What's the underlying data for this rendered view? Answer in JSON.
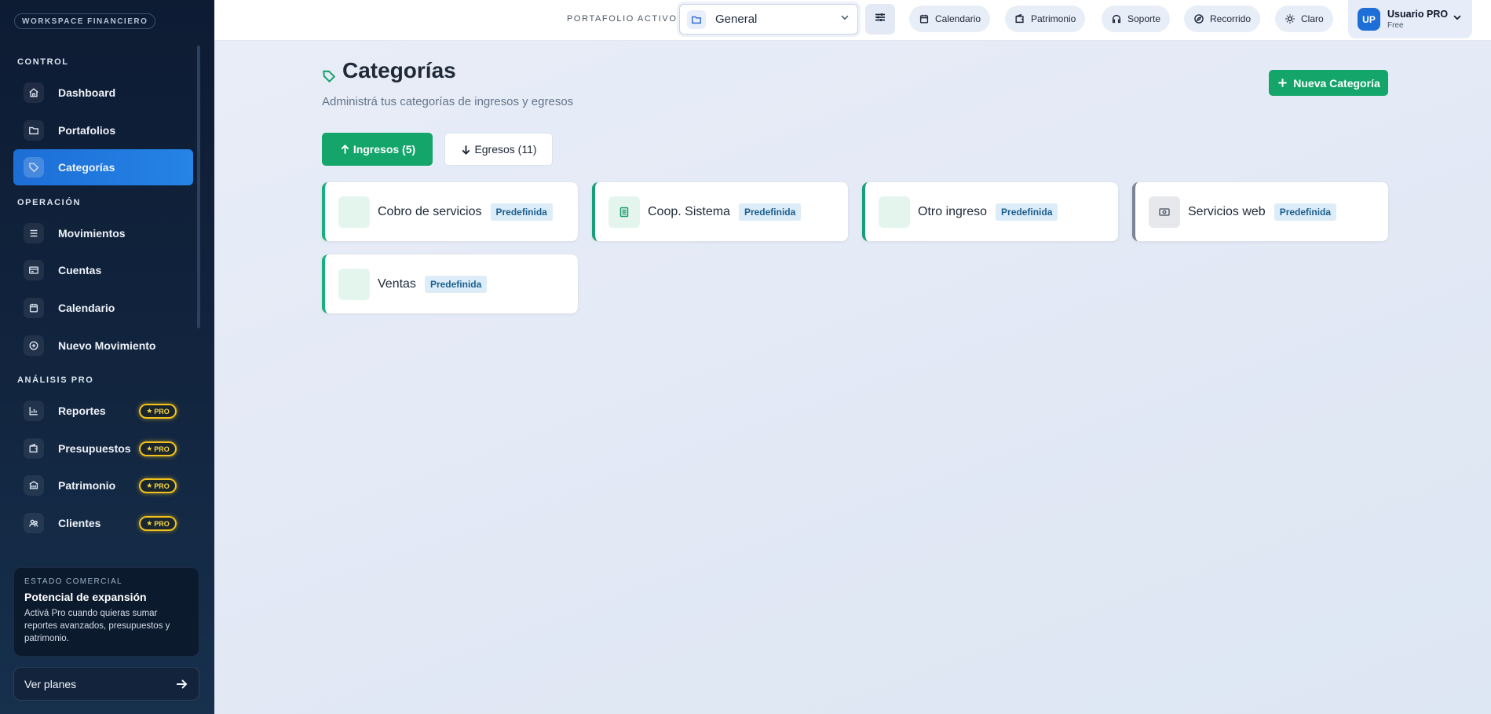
{
  "sidebar": {
    "workspace": "WORKSPACE FINANCIERO",
    "sections": {
      "control": "CONTROL",
      "operacion": "OPERACIÓN",
      "analisis": "ANÁLISIS PRO"
    },
    "items": [
      {
        "label": "Dashboard",
        "icon": "home-icon"
      },
      {
        "label": "Portafolios",
        "icon": "folder-icon"
      },
      {
        "label": "Categorías",
        "icon": "tag-icon",
        "active": true
      },
      {
        "label": "Movimientos",
        "icon": "list-icon"
      },
      {
        "label": "Cuentas",
        "icon": "card-icon"
      },
      {
        "label": "Calendario",
        "icon": "calendar-icon"
      },
      {
        "label": "Nuevo Movimiento",
        "icon": "plus-circle-icon"
      },
      {
        "label": "Reportes",
        "icon": "chart-icon",
        "pro": "PRO"
      },
      {
        "label": "Presupuestos",
        "icon": "wallet-icon",
        "pro": "PRO"
      },
      {
        "label": "Patrimonio",
        "icon": "bank-icon",
        "pro": "PRO"
      },
      {
        "label": "Clientes",
        "icon": "users-icon",
        "pro": "PRO"
      }
    ],
    "status_card": {
      "kicker": "ESTADO COMERCIAL",
      "title": "Potencial de expansión",
      "description": "Activá Pro cuando quieras sumar reportes avanzados, presupuestos y patrimonio."
    },
    "plans_label": "Ver planes"
  },
  "topbar": {
    "portfolio_label": "PORTAFOLIO ACTIVO",
    "portfolio_value": "General",
    "pills": [
      "Calendario",
      "Patrimonio",
      "Soporte",
      "Recorrido",
      "Claro"
    ],
    "user": {
      "initials": "UP",
      "name": "Usuario PRO",
      "plan": "Free"
    }
  },
  "main": {
    "title": "Categorías",
    "subtitle": "Administrá tus categorías de ingresos y egresos",
    "new_button": "Nueva Categoría",
    "tabs": {
      "ingresos": "Ingresos (5)",
      "egresos": "Egresos (11)"
    },
    "categories": [
      {
        "name": "Cobro de servicios",
        "badge": "Predefinida"
      },
      {
        "name": "Coop. Sistema",
        "badge": "Predefinida"
      },
      {
        "name": "Otro ingreso",
        "badge": "Predefinida"
      },
      {
        "name": "Servicios web",
        "badge": "Predefinida"
      },
      {
        "name": "Ventas",
        "badge": "Predefinida"
      }
    ]
  },
  "colors": {
    "accent_green": "#14a56a",
    "sidebar_active": "#1d6ed6",
    "pro_gold": "#f2c21b"
  }
}
